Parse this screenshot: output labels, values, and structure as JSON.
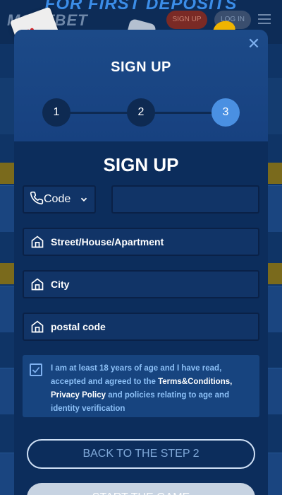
{
  "background": {
    "banner": "FOR FIRST DEPOSITS",
    "logo": "MOSTBET",
    "signup_label": "SIGN UP",
    "login_label": "LOG IN"
  },
  "modal": {
    "header_title": "SIGN UP",
    "close_glyph": "✕",
    "steps": [
      {
        "label": "1",
        "active": false
      },
      {
        "label": "2",
        "active": false
      },
      {
        "label": "3",
        "active": true
      }
    ],
    "form_title": "SIGN UP",
    "code_label": "Code",
    "phone_value": "",
    "fields": [
      {
        "label": "Street/House/Apartment",
        "icon": "home-icon"
      },
      {
        "label": "City",
        "icon": "home-icon"
      },
      {
        "label": "postal code",
        "icon": "home-icon"
      }
    ],
    "terms": {
      "checked": true,
      "text_1": "I am at least 18 years of age and I have read, accepted and agreed to the ",
      "link_terms": "Terms&Conditions",
      "sep": ", ",
      "link_privacy": "Privacy Policy",
      "text_2": " and policies relating to age and identity verification"
    },
    "back_button": "BACK TO THE STEP 2",
    "start_button": "START THE GAME"
  },
  "colors": {
    "accent": "#4a90e2",
    "modal_bg": "#0c2d5c",
    "link_text": "#8cc0f7"
  }
}
